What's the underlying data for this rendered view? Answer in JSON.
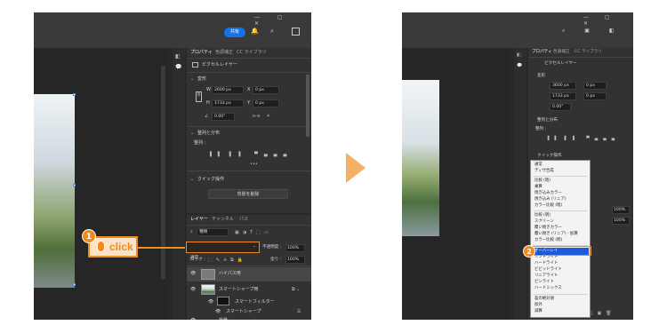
{
  "left": {
    "share_label": "共有",
    "tabs": [
      "プロパティ",
      "色調補正",
      "CC ライブラリ"
    ],
    "layer_kind": "ピクセルレイヤー",
    "transform": {
      "title": "変形",
      "w_label": "W",
      "w": "2600 px",
      "h_label": "H",
      "h": "1733 px",
      "x_label": "X",
      "x": "0 px",
      "y_label": "Y",
      "y": "0 px",
      "angle": "0.00°"
    },
    "align": {
      "title": "整列と分布",
      "sub": "整列 :"
    },
    "quick": {
      "title": "クイック操作",
      "button": "背景を削除"
    },
    "layers_tabs": [
      "レイヤー",
      "チャンネル",
      "パス"
    ],
    "kind": "種類",
    "blend": "通常",
    "opacity_label": "不透明度 :",
    "opacity": "100%",
    "lock_label": "ロック :",
    "fill_label": "塗り :",
    "fill": "100%",
    "layers": [
      "ハイパス用",
      "スマートシャープ用",
      "スマートフィルター",
      "スマートシャープ",
      "背景"
    ]
  },
  "callout1": {
    "number": "1",
    "text": "click",
    "color": "#f0891e"
  },
  "callout2": {
    "number": "2",
    "color": "#f0891e"
  },
  "right": {
    "tabs": [
      "プロパティ",
      "色調補正",
      "CC ライブラリ"
    ],
    "layer_kind": "ピクセルレイヤー",
    "transform": {
      "title": "変形",
      "w": "3600 px",
      "h": "1733 px",
      "x": "0 px",
      "y": "0 px",
      "angle": "0.00°"
    },
    "align_title": "整列と分布",
    "align_sub": "整列 :",
    "quick_title": "クイック操作",
    "opacity": "100%",
    "fill": "100%",
    "menu_groups": [
      [
        "通常",
        "ディザ合成"
      ],
      [
        "比較 (暗)",
        "乗算",
        "焼き込みカラー",
        "焼き込み (リニア)",
        "カラー比較 (暗)"
      ],
      [
        "比較 (明)",
        "スクリーン",
        "覆い焼きカラー",
        "覆い焼き (リニア) - 加算",
        "カラー比較 (明)"
      ],
      [
        "オーバーレイ",
        "ソフトライト",
        "ハードライト",
        "ビビッドライト",
        "リニアライト",
        "ピンライト",
        "ハードミックス"
      ],
      [
        "差の絶対値",
        "除外",
        "減算"
      ]
    ]
  },
  "arrow_color": "#f5b066"
}
